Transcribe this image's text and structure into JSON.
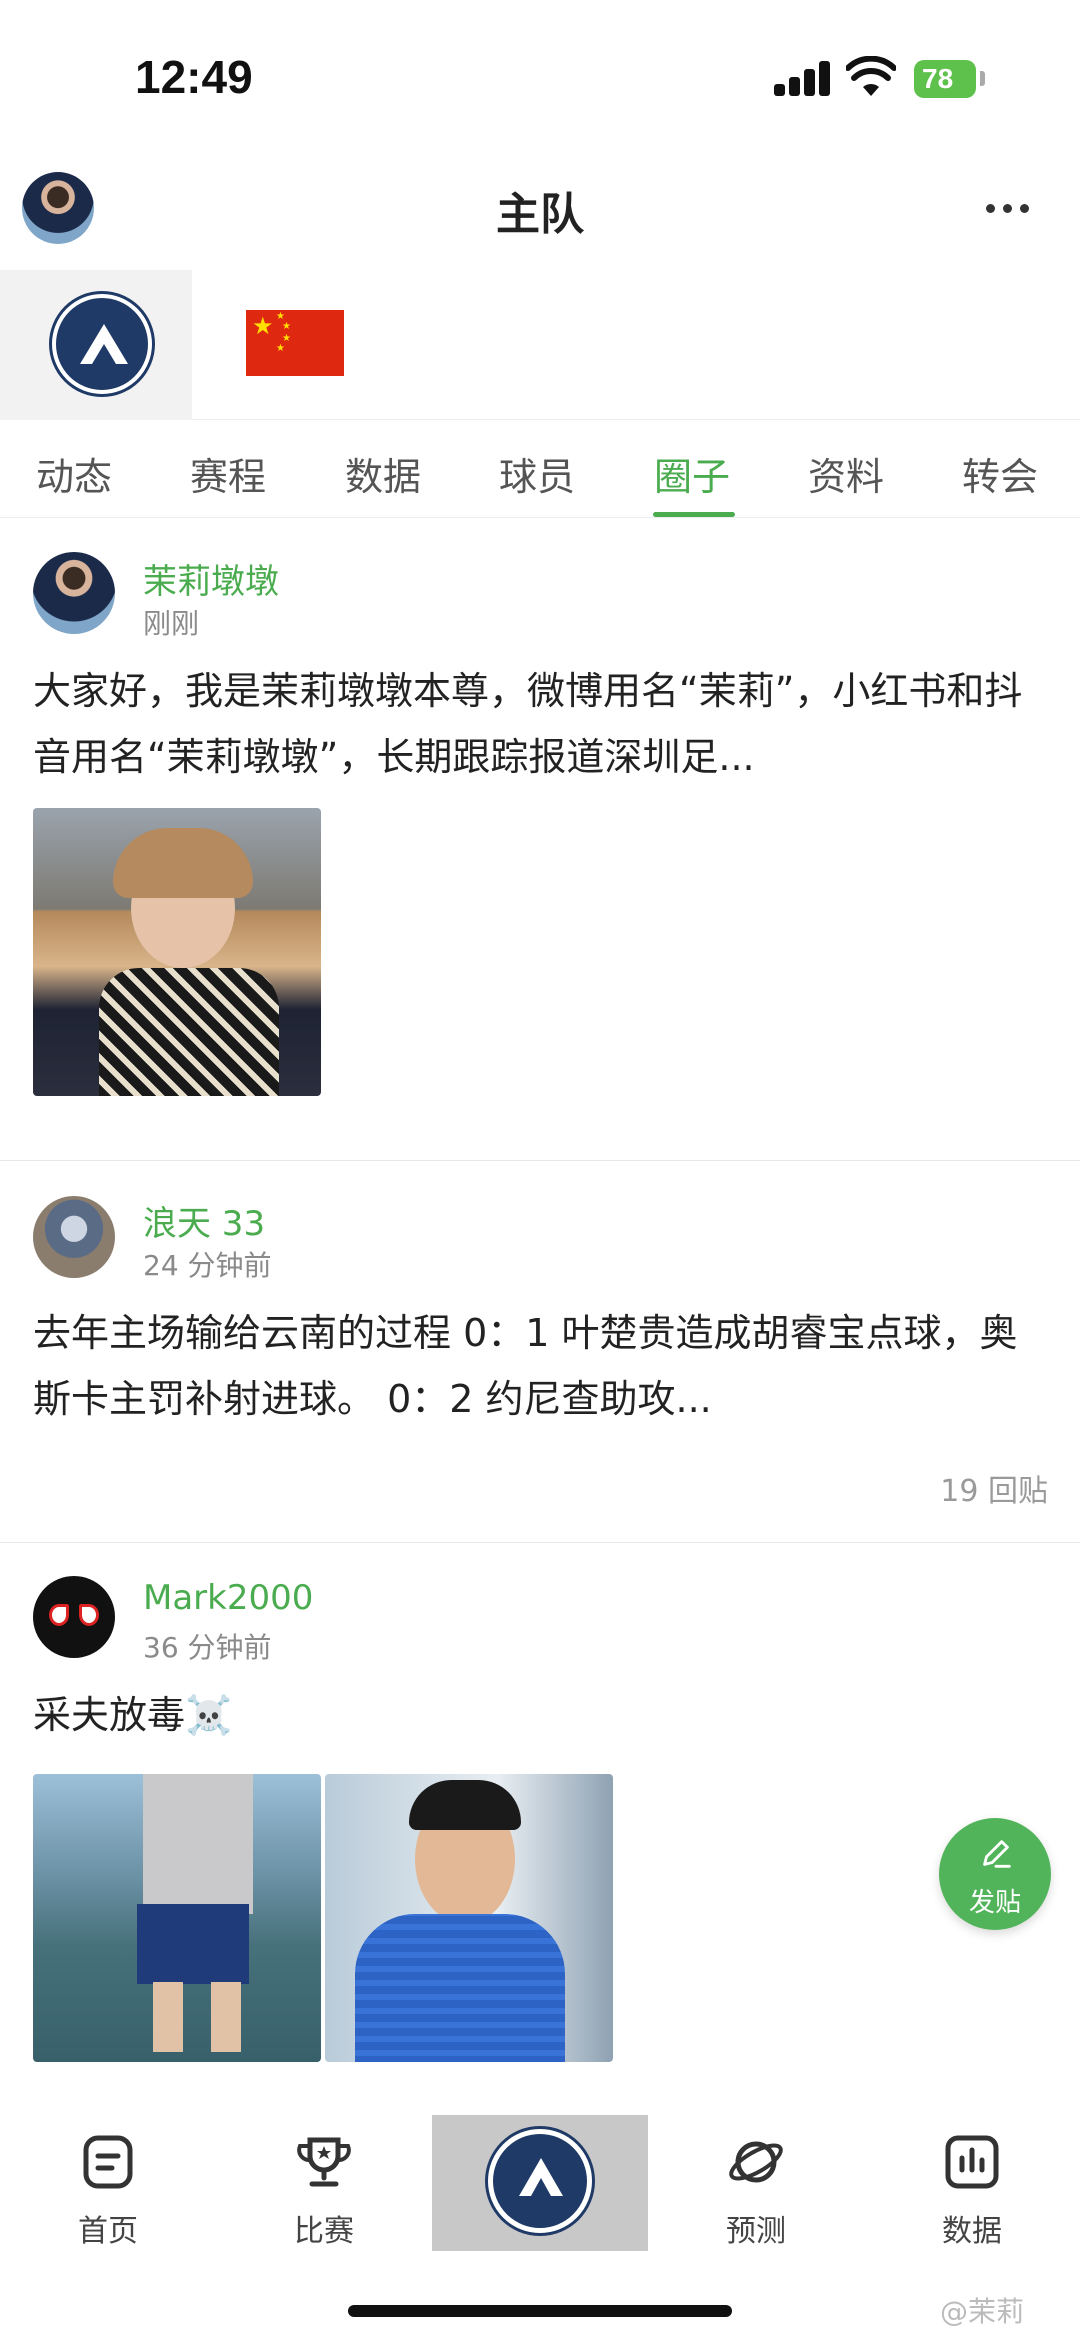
{
  "status_bar": {
    "time": "12:49",
    "battery": "78"
  },
  "header": {
    "title": "主队"
  },
  "tabs": [
    {
      "label": "动态"
    },
    {
      "label": "赛程"
    },
    {
      "label": "数据"
    },
    {
      "label": "球员"
    },
    {
      "label": "圈子",
      "active": true
    },
    {
      "label": "资料"
    },
    {
      "label": "转会"
    }
  ],
  "posts": [
    {
      "author": "茉莉墩墩",
      "time": "刚刚",
      "text": "大家好，我是茉莉墩墩本尊，微博用名“茉莉”，小红书和抖音用名“茉莉墩墩”，长期跟踪报道深圳足..."
    },
    {
      "author": "浪天 33",
      "time": "24 分钟前",
      "text": "去年主场输给云南的过程 0：1 叶楚贵造成胡睿宝点球，奥斯卡主罚补射进球。 0：2 约尼查助攻...",
      "replies": "19 回贴"
    },
    {
      "author": "Mark2000",
      "time": "36 分钟前",
      "text": "采夫放毒☠️"
    }
  ],
  "fab": {
    "label": "发贴"
  },
  "bottom_nav": [
    {
      "label": "首页",
      "icon": "home-icon"
    },
    {
      "label": "比赛",
      "icon": "trophy-icon"
    },
    {
      "label": "",
      "icon": "club-logo"
    },
    {
      "label": "预测",
      "icon": "planet-icon"
    },
    {
      "label": "数据",
      "icon": "bar-chart-icon"
    }
  ],
  "watermark": "@茉莉",
  "colors": {
    "accent": "#4aac4f",
    "club_navy": "#1f3a66",
    "flag_red": "#de2910"
  }
}
